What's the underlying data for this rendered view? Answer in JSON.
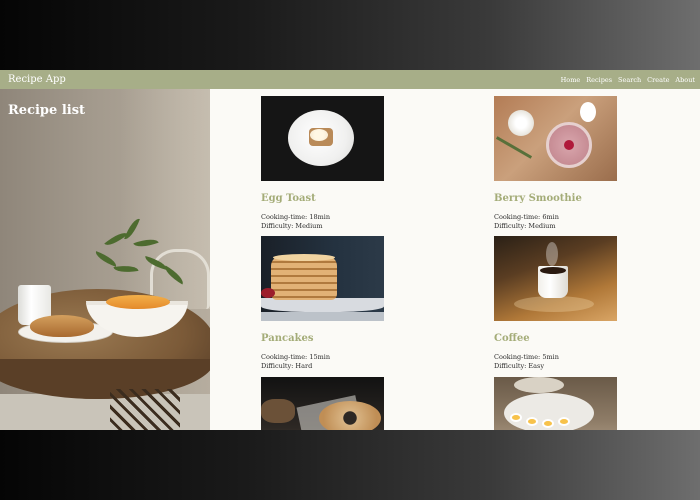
{
  "navbar": {
    "brand": "Recipe App",
    "links": [
      {
        "label": "Home"
      },
      {
        "label": "Recipes"
      },
      {
        "label": "Search"
      },
      {
        "label": "Create"
      },
      {
        "label": "About"
      }
    ]
  },
  "hero": {
    "title": "Recipe list"
  },
  "recipes": [
    {
      "title": "Egg Toast",
      "cooking_time": "Cooking-time: 18min",
      "difficulty": "Difficulty: Medium",
      "image": "egg-toast-photo"
    },
    {
      "title": "Berry Smoothie",
      "cooking_time": "Cooking-time: 6min",
      "difficulty": "Difficulty: Medium",
      "image": "berry-smoothie-photo"
    },
    {
      "title": "Pancakes",
      "cooking_time": "Cooking-time: 15min",
      "difficulty": "Difficulty: Hard",
      "image": "pancakes-photo"
    },
    {
      "title": "Coffee",
      "cooking_time": "Cooking-time: 5min",
      "difficulty": "Difficulty: Easy",
      "image": "coffee-photo"
    },
    {
      "title": "",
      "cooking_time": "",
      "difficulty": "",
      "image": "bagel-photo"
    },
    {
      "title": "",
      "cooking_time": "",
      "difficulty": "",
      "image": "breakfast-platter-photo"
    }
  ],
  "colors": {
    "navbar": "#a7ae88",
    "recipe_title": "#a4ac78",
    "page_background": "#fbfaf6"
  }
}
